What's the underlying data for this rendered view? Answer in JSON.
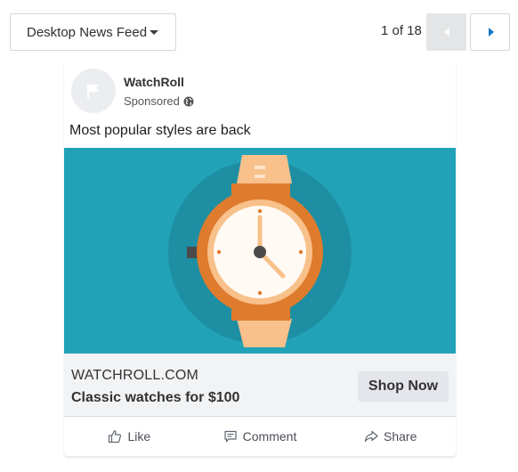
{
  "toolbar": {
    "placement_label": "Desktop News Feed",
    "pager_text": "1 of 18"
  },
  "post": {
    "page_name": "WatchRoll",
    "sponsored_label": "Sponsored",
    "primary_text": "Most popular styles are back",
    "link_domain": "WATCHROLL.COM",
    "link_headline": "Classic watches for $100",
    "cta_label": "Shop Now"
  },
  "actions": {
    "like_label": "Like",
    "comment_label": "Comment",
    "share_label": "Share"
  },
  "colors": {
    "image_background": "#22a2b7",
    "watch_case": "#df7b2c",
    "watch_strap": "#f8c08a",
    "accent_blue": "#1877c2"
  },
  "icons": [
    "chevron-down-icon",
    "prev-arrow-icon",
    "next-arrow-icon",
    "flag-icon",
    "globe-icon",
    "like-icon",
    "comment-icon",
    "share-icon"
  ]
}
